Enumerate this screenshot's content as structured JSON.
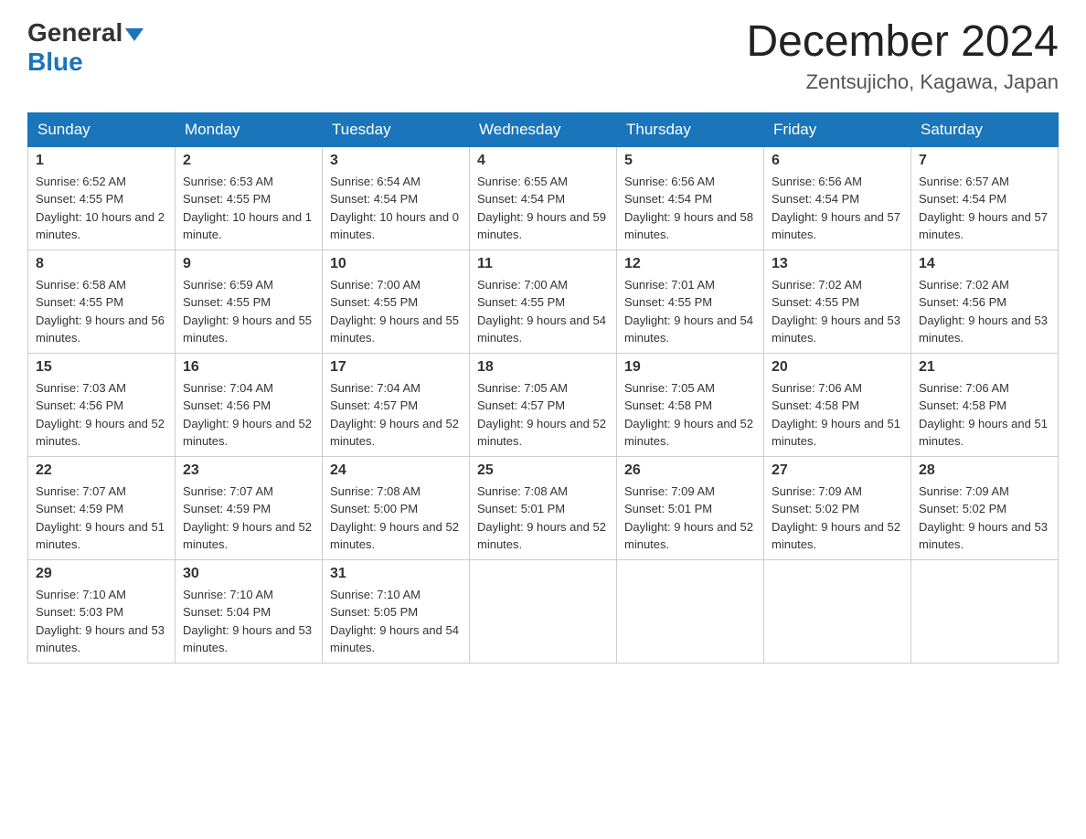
{
  "header": {
    "logo_general": "General",
    "logo_blue": "Blue",
    "month_title": "December 2024",
    "location": "Zentsujicho, Kagawa, Japan"
  },
  "calendar": {
    "days_of_week": [
      "Sunday",
      "Monday",
      "Tuesday",
      "Wednesday",
      "Thursday",
      "Friday",
      "Saturday"
    ],
    "weeks": [
      [
        {
          "day": "1",
          "sunrise": "6:52 AM",
          "sunset": "4:55 PM",
          "daylight": "10 hours and 2 minutes."
        },
        {
          "day": "2",
          "sunrise": "6:53 AM",
          "sunset": "4:55 PM",
          "daylight": "10 hours and 1 minute."
        },
        {
          "day": "3",
          "sunrise": "6:54 AM",
          "sunset": "4:54 PM",
          "daylight": "10 hours and 0 minutes."
        },
        {
          "day": "4",
          "sunrise": "6:55 AM",
          "sunset": "4:54 PM",
          "daylight": "9 hours and 59 minutes."
        },
        {
          "day": "5",
          "sunrise": "6:56 AM",
          "sunset": "4:54 PM",
          "daylight": "9 hours and 58 minutes."
        },
        {
          "day": "6",
          "sunrise": "6:56 AM",
          "sunset": "4:54 PM",
          "daylight": "9 hours and 57 minutes."
        },
        {
          "day": "7",
          "sunrise": "6:57 AM",
          "sunset": "4:54 PM",
          "daylight": "9 hours and 57 minutes."
        }
      ],
      [
        {
          "day": "8",
          "sunrise": "6:58 AM",
          "sunset": "4:55 PM",
          "daylight": "9 hours and 56 minutes."
        },
        {
          "day": "9",
          "sunrise": "6:59 AM",
          "sunset": "4:55 PM",
          "daylight": "9 hours and 55 minutes."
        },
        {
          "day": "10",
          "sunrise": "7:00 AM",
          "sunset": "4:55 PM",
          "daylight": "9 hours and 55 minutes."
        },
        {
          "day": "11",
          "sunrise": "7:00 AM",
          "sunset": "4:55 PM",
          "daylight": "9 hours and 54 minutes."
        },
        {
          "day": "12",
          "sunrise": "7:01 AM",
          "sunset": "4:55 PM",
          "daylight": "9 hours and 54 minutes."
        },
        {
          "day": "13",
          "sunrise": "7:02 AM",
          "sunset": "4:55 PM",
          "daylight": "9 hours and 53 minutes."
        },
        {
          "day": "14",
          "sunrise": "7:02 AM",
          "sunset": "4:56 PM",
          "daylight": "9 hours and 53 minutes."
        }
      ],
      [
        {
          "day": "15",
          "sunrise": "7:03 AM",
          "sunset": "4:56 PM",
          "daylight": "9 hours and 52 minutes."
        },
        {
          "day": "16",
          "sunrise": "7:04 AM",
          "sunset": "4:56 PM",
          "daylight": "9 hours and 52 minutes."
        },
        {
          "day": "17",
          "sunrise": "7:04 AM",
          "sunset": "4:57 PM",
          "daylight": "9 hours and 52 minutes."
        },
        {
          "day": "18",
          "sunrise": "7:05 AM",
          "sunset": "4:57 PM",
          "daylight": "9 hours and 52 minutes."
        },
        {
          "day": "19",
          "sunrise": "7:05 AM",
          "sunset": "4:58 PM",
          "daylight": "9 hours and 52 minutes."
        },
        {
          "day": "20",
          "sunrise": "7:06 AM",
          "sunset": "4:58 PM",
          "daylight": "9 hours and 51 minutes."
        },
        {
          "day": "21",
          "sunrise": "7:06 AM",
          "sunset": "4:58 PM",
          "daylight": "9 hours and 51 minutes."
        }
      ],
      [
        {
          "day": "22",
          "sunrise": "7:07 AM",
          "sunset": "4:59 PM",
          "daylight": "9 hours and 51 minutes."
        },
        {
          "day": "23",
          "sunrise": "7:07 AM",
          "sunset": "4:59 PM",
          "daylight": "9 hours and 52 minutes."
        },
        {
          "day": "24",
          "sunrise": "7:08 AM",
          "sunset": "5:00 PM",
          "daylight": "9 hours and 52 minutes."
        },
        {
          "day": "25",
          "sunrise": "7:08 AM",
          "sunset": "5:01 PM",
          "daylight": "9 hours and 52 minutes."
        },
        {
          "day": "26",
          "sunrise": "7:09 AM",
          "sunset": "5:01 PM",
          "daylight": "9 hours and 52 minutes."
        },
        {
          "day": "27",
          "sunrise": "7:09 AM",
          "sunset": "5:02 PM",
          "daylight": "9 hours and 52 minutes."
        },
        {
          "day": "28",
          "sunrise": "7:09 AM",
          "sunset": "5:02 PM",
          "daylight": "9 hours and 53 minutes."
        }
      ],
      [
        {
          "day": "29",
          "sunrise": "7:10 AM",
          "sunset": "5:03 PM",
          "daylight": "9 hours and 53 minutes."
        },
        {
          "day": "30",
          "sunrise": "7:10 AM",
          "sunset": "5:04 PM",
          "daylight": "9 hours and 53 minutes."
        },
        {
          "day": "31",
          "sunrise": "7:10 AM",
          "sunset": "5:05 PM",
          "daylight": "9 hours and 54 minutes."
        },
        null,
        null,
        null,
        null
      ]
    ]
  }
}
